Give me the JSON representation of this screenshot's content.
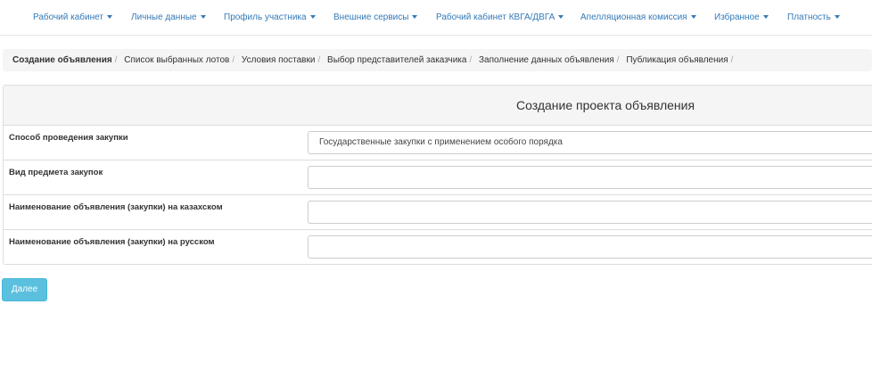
{
  "nav": {
    "items": [
      {
        "label": "Рабочий кабинет"
      },
      {
        "label": "Личные данные"
      },
      {
        "label": "Профиль участника"
      },
      {
        "label": "Внешние сервисы"
      },
      {
        "label": "Рабочий кабинет КВГА/ДВГА"
      },
      {
        "label": "Апелляционная комиссия"
      },
      {
        "label": "Избранное"
      },
      {
        "label": "Платность"
      }
    ]
  },
  "breadcrumb": {
    "separator": "/",
    "items": [
      {
        "label": "Создание объявления"
      },
      {
        "label": "Список выбранных лотов"
      },
      {
        "label": "Условия поставки"
      },
      {
        "label": "Выбор представителей заказчика"
      },
      {
        "label": "Заполнение данных объявления"
      },
      {
        "label": "Публикация объявления"
      }
    ]
  },
  "panel": {
    "title": "Создание проекта объявления",
    "fields": [
      {
        "label": "Способ проведения закупки",
        "value": "Государственные закупки с применением особого порядка"
      },
      {
        "label": "Вид предмета закупок",
        "value": ""
      },
      {
        "label": "Наименование объявления (закупки) на казахском",
        "value": ""
      },
      {
        "label": "Наименование объявления (закупки) на русском",
        "value": ""
      }
    ]
  },
  "actions": {
    "next_label": "Далее"
  },
  "colors": {
    "link": "#337ab7",
    "info_button": "#5bc0de",
    "panel_heading": "#f5f5f5"
  }
}
